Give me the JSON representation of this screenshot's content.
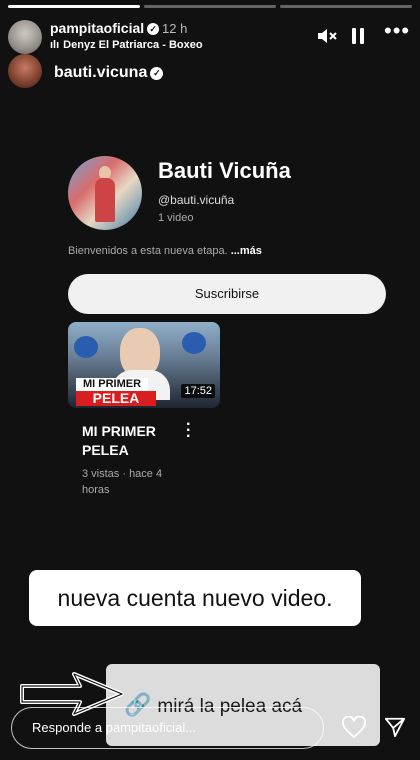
{
  "header": {
    "username": "pampitaoficial",
    "time": "12 h",
    "music": "Denyz El Patriarca - Boxeo"
  },
  "mention": {
    "username": "bauti.vicuna"
  },
  "channel": {
    "name": "Bauti Vicuña",
    "handle": "@bauti.vicuña",
    "videos": "1 video",
    "bio": "Bienvenidos a esta nueva etapa.",
    "bio_more": "...más",
    "subscribe_label": "Suscribirse"
  },
  "video": {
    "thumb_line1": "MI PRIMER",
    "thumb_line2": "PELEA",
    "duration": "17:52",
    "title": "MI PRIMER PELEA",
    "meta": "3 vistas · hace 4 horas"
  },
  "caption": "nueva cuenta nuevo video.",
  "link_sticker": {
    "label": "mirá la pelea acá"
  },
  "reply": {
    "placeholder": "Responde a pampitaoficial..."
  },
  "icons": {
    "mute": "speaker-muted-icon",
    "pause": "pause-icon",
    "more": "more-horizontal-icon",
    "heart": "heart-icon",
    "send": "send-icon",
    "link": "link-icon",
    "arrow": "arrow-right-icon",
    "music": "audio-bars-icon",
    "verified": "verified-badge-icon"
  }
}
